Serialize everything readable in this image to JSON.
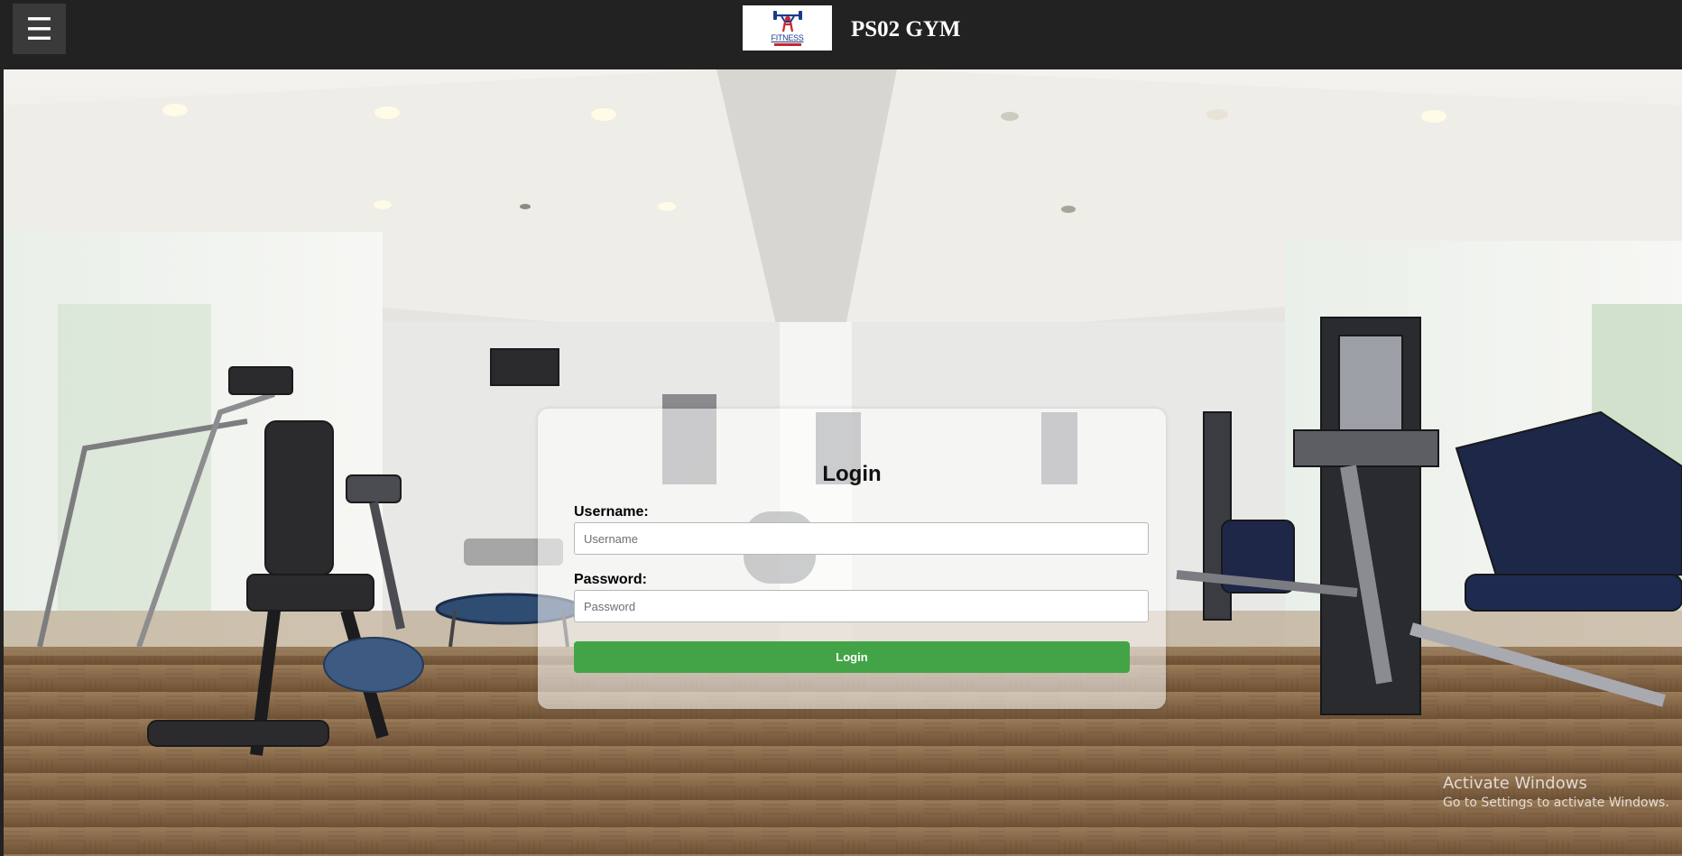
{
  "header": {
    "menu_icon": "☰",
    "logo_text": "FITNESS",
    "site_title": "PS02 GYM"
  },
  "login": {
    "title": "Login",
    "username_label": "Username:",
    "username_placeholder": "Username",
    "username_value": "",
    "password_label": "Password:",
    "password_placeholder": "Password",
    "password_value": "",
    "submit_label": "Login"
  },
  "watermark": {
    "title": "Activate Windows",
    "subtitle": "Go to Settings to activate Windows."
  },
  "colors": {
    "topbar": "#222222",
    "menu_button": "#3a3a3a",
    "login_button": "#43a447"
  }
}
